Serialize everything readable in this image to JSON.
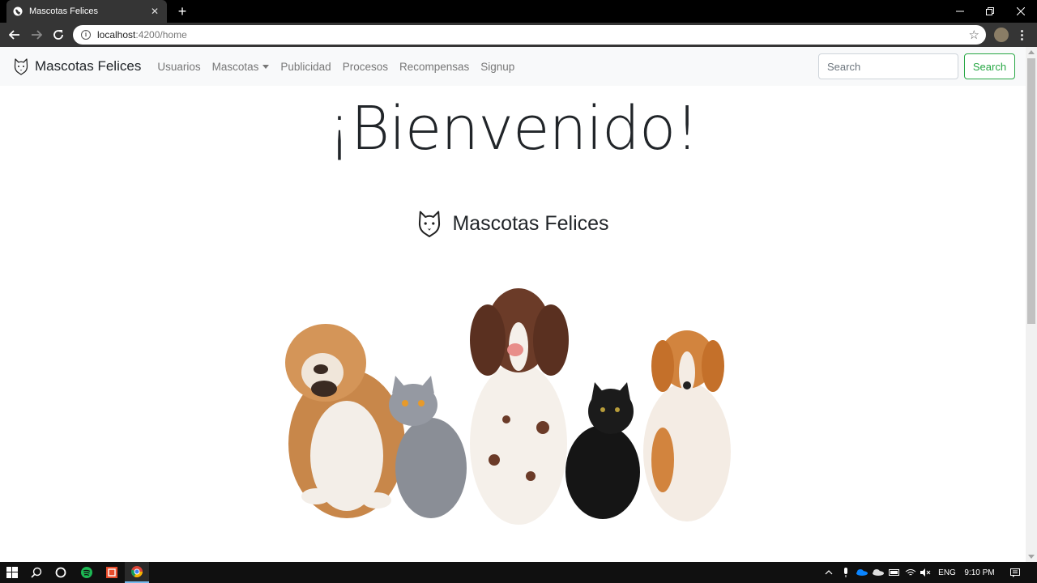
{
  "browser": {
    "tab_title": "Mascotas Felices",
    "tab_close": "✕",
    "new_tab": "+",
    "url_host": "localhost",
    "url_path": ":4200/home"
  },
  "navbar": {
    "brand": "Mascotas Felices",
    "links": [
      "Usuarios",
      "Mascotas",
      "Publicidad",
      "Procesos",
      "Recompensas",
      "Signup"
    ],
    "search_placeholder": "Search",
    "search_button": "Search"
  },
  "main": {
    "heading": "¡Bienvenido!",
    "subbrand": "Mascotas Felices"
  },
  "taskbar": {
    "language": "ENG",
    "time": "9:10 PM"
  },
  "colors": {
    "success": "#28a745",
    "navbar_bg": "#f8f9fa",
    "chrome_dark": "#353535"
  }
}
